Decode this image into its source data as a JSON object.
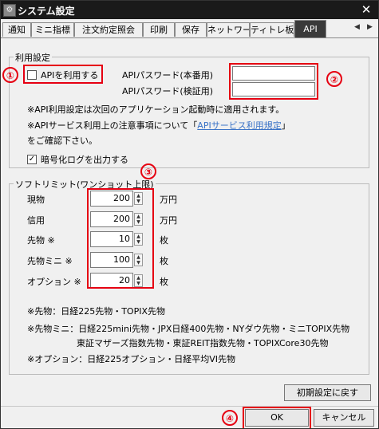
{
  "window": {
    "title": "システム設定",
    "close_symbol": "✕",
    "app_icon_text": "⚙"
  },
  "tabs": [
    "通知",
    "ミニ指標",
    "注文約定照会",
    "印刷",
    "保存",
    "ネットワーク",
    "ティトレ板",
    "API"
  ],
  "tab_nav": {
    "left": "◀",
    "right": "▶"
  },
  "api_group": {
    "label": "利用設定",
    "use_api_label": "APIを利用する",
    "use_api_checked": false,
    "password_prod_label": "APIパスワード(本番用)",
    "password_prod_value": "",
    "password_test_label": "APIパスワード(検証用)",
    "password_test_value": "",
    "note1": "※API利用設定は次回のアプリケーション起動時に適用されます。",
    "note2_prefix": "※APIサービス利用上の注意事項について「",
    "note2_link": "APIサービス利用規定",
    "note2_suffix": "」",
    "note3": "をご確認下さい。",
    "encrypt_log_label": "暗号化ログを出力する",
    "encrypt_log_checked": true,
    "check_mark": "✓"
  },
  "soft_limit": {
    "label": "ソフトリミット(ワンショット上限)",
    "rows": [
      {
        "label": "現物",
        "value": "200",
        "unit": "万円"
      },
      {
        "label": "信用",
        "value": "200",
        "unit": "万円"
      },
      {
        "label": "先物 ※",
        "value": "10",
        "unit": "枚"
      },
      {
        "label": "先物ミニ ※",
        "value": "100",
        "unit": "枚"
      },
      {
        "label": "オプション ※",
        "value": "20",
        "unit": "枚"
      }
    ],
    "spin_up": "▲",
    "spin_down": "▼",
    "notes": [
      "※先物：日経225先物・TOPIX先物",
      "※先物ミニ：日経225mini先物・JPX日経400先物・NYダウ先物・ミニTOPIX先物",
      "東証マザーズ指数先物・東証REIT指数先物・TOPIXCore30先物",
      "※オプション：日経225オプション・日経平均VI先物"
    ]
  },
  "buttons": {
    "reset": "初期設定に戻す",
    "ok": "OK",
    "cancel": "キャンセル"
  },
  "annotations": {
    "b1": "①",
    "b2": "②",
    "b3": "③",
    "b4": "④"
  },
  "colors": {
    "annotation": "#e60012",
    "link": "#3b73c7",
    "active_tab": "#3a3a3a",
    "titlebar": "#1a1a1a"
  }
}
